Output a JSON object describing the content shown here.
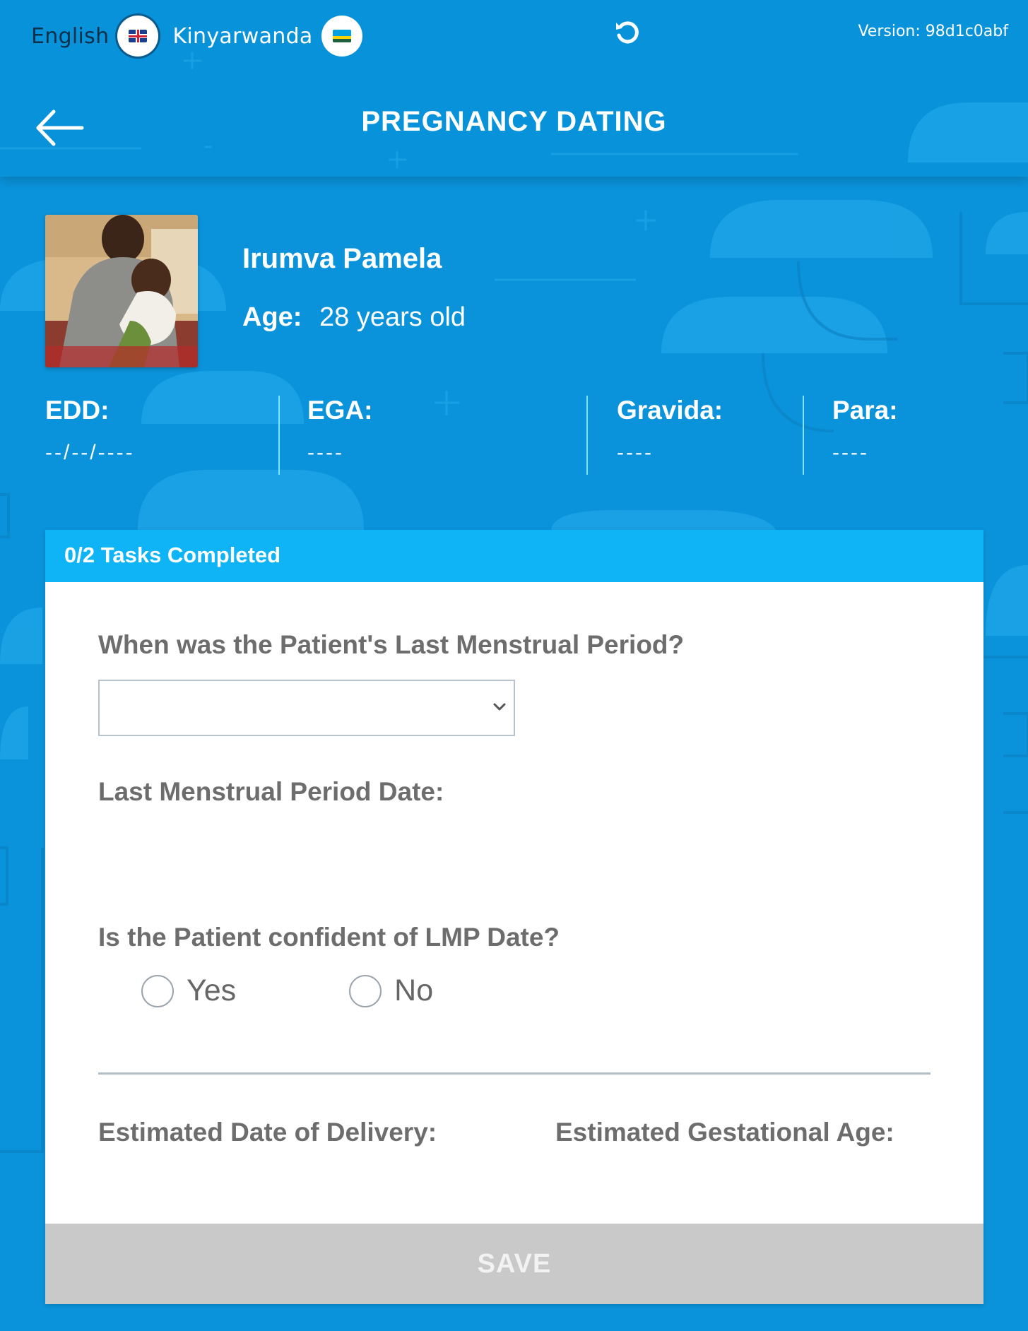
{
  "languages": {
    "english": "English",
    "kinyarwanda": "Kinyarwanda"
  },
  "version": "Version: 98d1c0abf",
  "title": "PREGNANCY DATING",
  "patient": {
    "name": "Irumva Pamela",
    "age_label": "Age:",
    "age_value": "28 years old"
  },
  "stats": [
    {
      "label": "EDD:",
      "value": "--/--/----"
    },
    {
      "label": "EGA:",
      "value": "----"
    },
    {
      "label": "Gravida:",
      "value": "----"
    },
    {
      "label": "Para:",
      "value": "----"
    }
  ],
  "form": {
    "tasks": "0/2 Tasks Completed",
    "lmp_question": "When was the Patient's Last Menstrual Period?",
    "lmp_select_value": "",
    "lmp_date_label": "Last Menstrual Period Date:",
    "confidence_question": "Is the Patient confident of LMP Date?",
    "yes": "Yes",
    "no": "No",
    "edd_label": "Estimated Date of Delivery:",
    "ega_label": "Estimated Gestational Age:",
    "save": "SAVE"
  },
  "colors": {
    "background": "#0a93db",
    "header_strip": "#0fb4f7",
    "save_disabled": "#c9c9c9"
  }
}
